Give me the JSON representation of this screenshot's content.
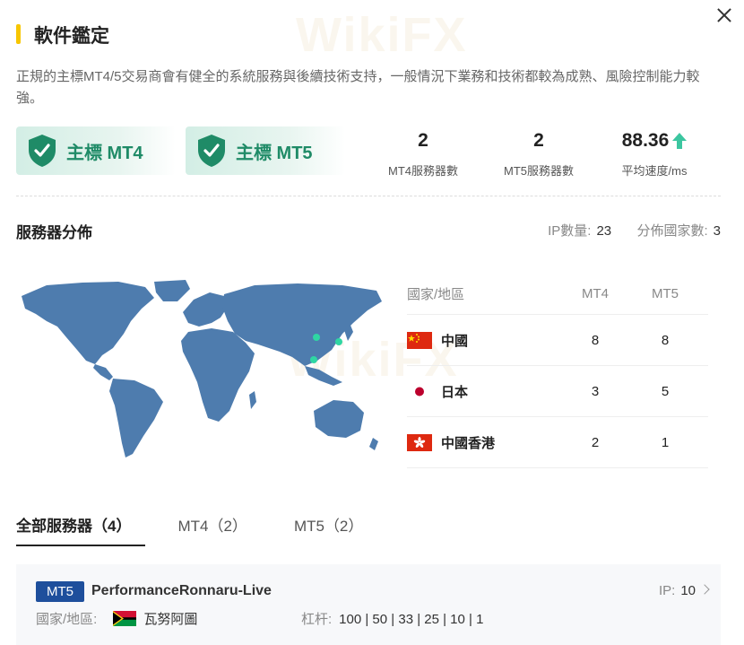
{
  "header": {
    "title": "軟件鑑定"
  },
  "description": "正規的主標MT4/5交易商會有健全的系統服務與後續技術支持，一般情況下業務和技術都較為成熟、風險控制能力較強。",
  "badges": [
    {
      "label": "主標 MT4"
    },
    {
      "label": "主標 MT5"
    }
  ],
  "stats": [
    {
      "value": "2",
      "label": "MT4服務器數"
    },
    {
      "value": "2",
      "label": "MT5服務器數"
    },
    {
      "value": "88.36",
      "label": "平均速度/ms"
    }
  ],
  "distribution": {
    "title": "服務器分佈",
    "ip_label": "IP數量:",
    "ip_count": "23",
    "country_label": "分佈國家數:",
    "country_count": "3"
  },
  "table": {
    "headers": [
      "國家/地區",
      "MT4",
      "MT5"
    ],
    "rows": [
      {
        "country": "中國",
        "mt4": "8",
        "mt5": "8"
      },
      {
        "country": "日本",
        "mt4": "3",
        "mt5": "5"
      },
      {
        "country": "中國香港",
        "mt4": "2",
        "mt5": "1"
      }
    ]
  },
  "tabs": [
    {
      "label": "全部服務器（4）"
    },
    {
      "label": "MT4（2）"
    },
    {
      "label": "MT5（2）"
    }
  ],
  "server": {
    "tag": "MT5",
    "name": "PerformanceRonnaru-Live",
    "ip_label": "IP:",
    "ip_count": "10",
    "region_label": "國家/地區:",
    "region_value": "瓦努阿圖",
    "leverage_label": "杠杆:",
    "leverage_value": "100 | 50 | 33 | 25 | 10 | 1"
  },
  "watermark": "WikiFX",
  "colors": {
    "accent": "#f7c600",
    "brand_green": "#1f8b67",
    "map": "#4e7cae",
    "map_dot": "#2fd6a3",
    "tag_blue": "#1e4f9c"
  },
  "icons": {
    "close": "close-icon",
    "badge": "shield-check-icon",
    "speed": "up-arrow-icon",
    "chevron": "chevron-right-icon"
  }
}
